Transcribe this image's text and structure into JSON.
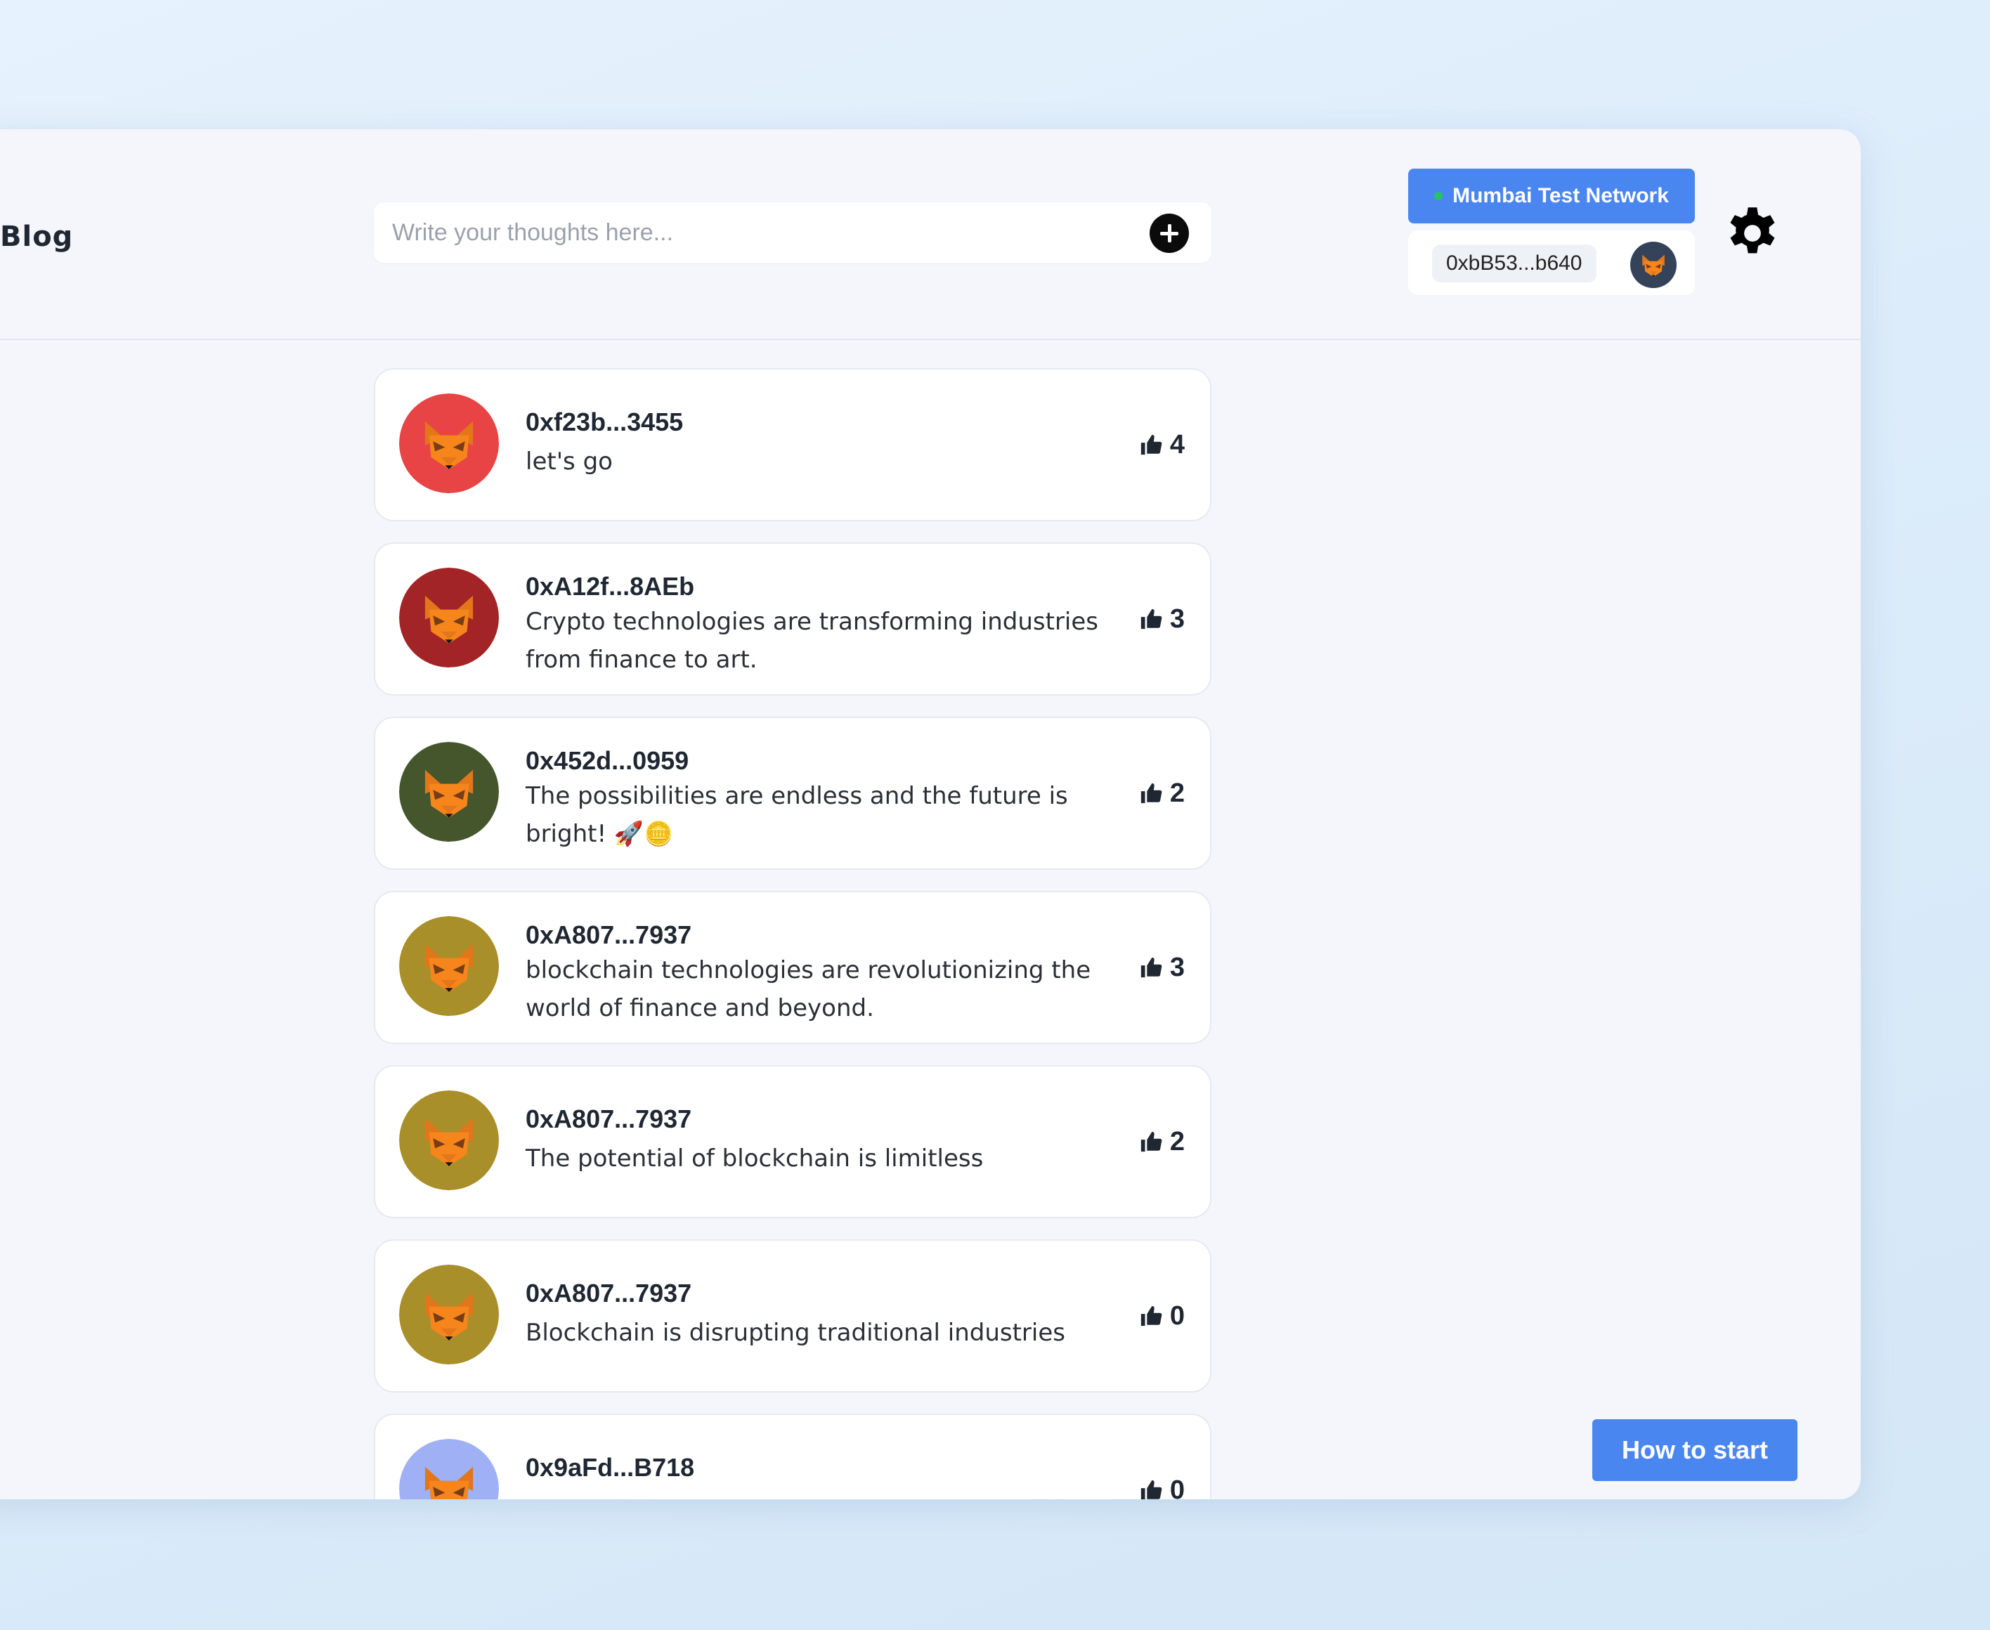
{
  "header": {
    "brand": "Blog",
    "compose_placeholder": "Write your thoughts here...",
    "network_label": "Mumbai Test Network",
    "wallet_address": "0xbB53...b640"
  },
  "posts": [
    {
      "author": "0xf23b...3455",
      "content": "let's go",
      "likes": "4",
      "avatar_color": "#e84446"
    },
    {
      "author": "0xA12f...8AEb",
      "content": "Crypto technologies are transforming industries from finance to art.",
      "likes": "3",
      "avatar_color": "#a32426"
    },
    {
      "author": "0x452d...0959",
      "content": "The possibilities are endless and the future is bright! 🚀🪙",
      "likes": "2",
      "avatar_color": "#45562c"
    },
    {
      "author": "0xA807...7937",
      "content": "blockchain technologies are revolutionizing the world of finance and beyond.",
      "likes": "3",
      "avatar_color": "#a88f2a"
    },
    {
      "author": "0xA807...7937",
      "content": "The potential of blockchain is limitless",
      "likes": "2",
      "avatar_color": "#a88f2a"
    },
    {
      "author": "0xA807...7937",
      "content": "Blockchain is disrupting traditional industries",
      "likes": "0",
      "avatar_color": "#a88f2a"
    },
    {
      "author": "0x9aFd...B718",
      "content": "",
      "likes": "0",
      "avatar_color": "#9fb0f4"
    }
  ],
  "footer": {
    "how_to_start_label": "How to start"
  },
  "colors": {
    "accent": "#4a86f0",
    "network_dot": "#27c26a"
  }
}
